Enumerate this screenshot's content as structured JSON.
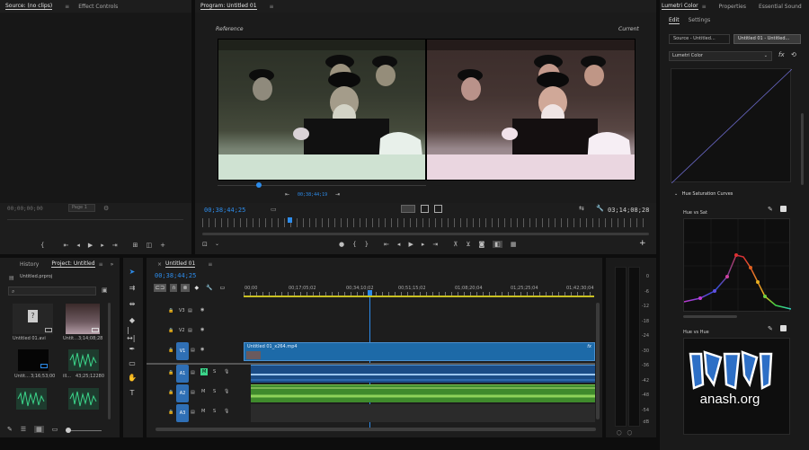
{
  "source_panel": {
    "tabs": [
      "Source: (no clips)",
      "Effect Controls"
    ],
    "timecode": "00;00;00;00",
    "page_select": "Page 1"
  },
  "program_panel": {
    "tab": "Program: Untitled 01",
    "reference_label": "Reference",
    "current_label": "Current",
    "ref_timecode": "00;38;44;19",
    "timecode": "00;38;44;25",
    "duration": "03;14;08;28"
  },
  "project_panel": {
    "tabs": [
      "History",
      "Project: Untitled"
    ],
    "project_file": "Untitled.prproj",
    "items": [
      {
        "name": "Untitled 01.avi",
        "dur": ""
      },
      {
        "name": "Untit...",
        "dur": "3;14;08;28"
      },
      {
        "name": "Untit...",
        "dur": "3;16;53;00"
      },
      {
        "name": "ill...",
        "dur": "43;25;12280"
      }
    ]
  },
  "timeline": {
    "tab": "Untitled 01",
    "timecode": "00;38;44;25",
    "ruler": [
      "00;00",
      "00;17;05;02",
      "00;34;10;02",
      "00;51;15;02",
      "01;08;20;04",
      "01;25;25;04",
      "01;42;30;04"
    ],
    "tracks": [
      "V3",
      "V2",
      "V1",
      "A1",
      "A2",
      "A3"
    ],
    "clip_name": "Untitled 01_x264.mp4",
    "track_mute": "M",
    "track_solo": "S"
  },
  "meter": {
    "labels": [
      "0",
      "-6",
      "-12",
      "-18",
      "-24",
      "-30",
      "-36",
      "-42",
      "-48",
      "-54",
      "dB"
    ]
  },
  "lumetri": {
    "tabs": [
      "Lumetri Color",
      "Properties",
      "Essential Sound"
    ],
    "subtabs": [
      "Edit",
      "Settings"
    ],
    "source_btn": "Source - Untitled...",
    "target_btn": "Untitled 01 - Untitled...",
    "effect": "Lumetri Color",
    "section": "Hue Saturation Curves",
    "curve1": "Hue vs Sat",
    "curve2": "Hue vs Hue",
    "watermark": "anash.org"
  }
}
